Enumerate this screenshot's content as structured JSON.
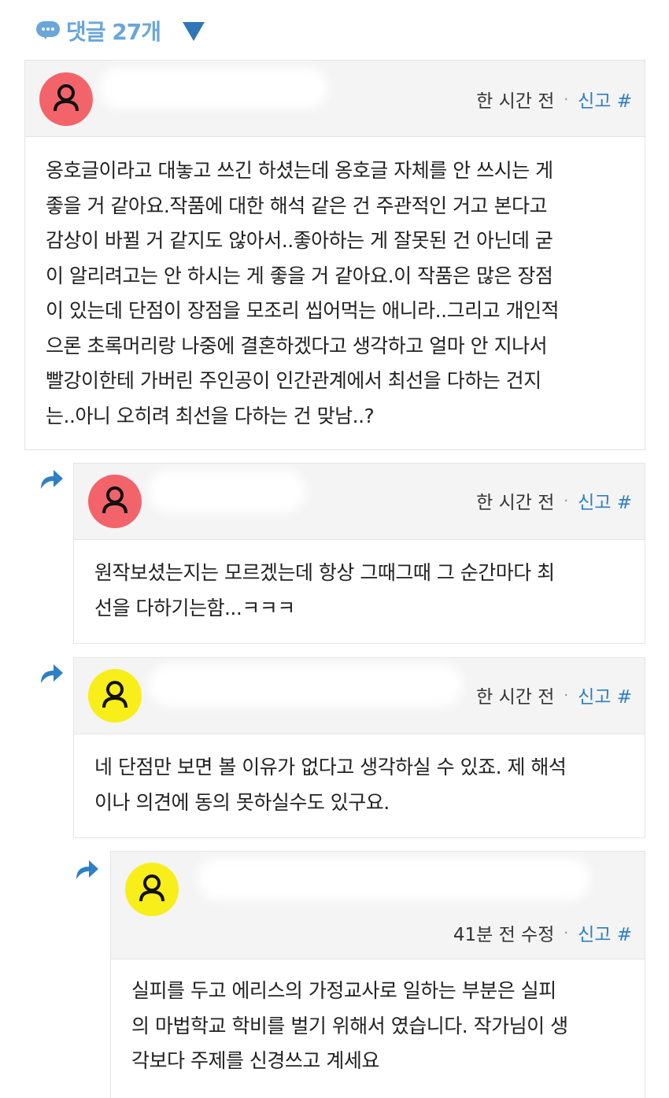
{
  "header": {
    "comment_count_label": "댓글 27개"
  },
  "colors": {
    "accent": "#2f7fc4",
    "avatar_red": "#f2646a",
    "avatar_yellow": "#f7ee1a"
  },
  "comments": [
    {
      "time": "한 시간 전",
      "report_label": "신고 #",
      "lines": [
        "옹호글이라고 대놓고 쓰긴 하셨는데 옹호글 자체를 안 쓰시는 게",
        "좋을 거 같아요.작품에 대한 해석 같은 건 주관적인 거고 본다고",
        "감상이 바뀔 거 같지도 않아서..좋아하는 게 잘못된 건 아닌데 굳",
        "이 알리려고는 안 하시는 게 좋을 거 같아요.이 작품은 많은 장점",
        "이 있는데 단점이 장점을 모조리 씹어먹는 애니라..그리고 개인적",
        "으론 초록머리랑 나중에 결혼하겠다고 생각하고 얼마 안 지나서",
        "빨강이한테 가버린 주인공이 인간관계에서 최선을 다하는 건지",
        "는..아니 오히려 최선을 다하는 건 맞남..?"
      ]
    },
    {
      "time": "한 시간 전",
      "report_label": "신고 #",
      "lines": [
        "원작보셨는지는 모르겠는데 항상 그때그때 그 순간마다 최",
        "선을 다하기는함...ㅋㅋㅋ"
      ]
    },
    {
      "time": "한 시간 전",
      "report_label": "신고 #",
      "lines": [
        "네 단점만 보면 볼 이유가 없다고 생각하실 수 있죠. 제 해석",
        "이나 의견에 동의 못하실수도 있구요."
      ]
    },
    {
      "time": "41분 전 수정",
      "report_label": "신고 #",
      "lines": [
        "실피를 두고 에리스의 가정교사로 일하는 부분은 실피",
        "의 마법학교 학비를 벌기 위해서 였습니다. 작가님이 생",
        "각보다 주제를 신경쓰고 계세요"
      ]
    }
  ]
}
